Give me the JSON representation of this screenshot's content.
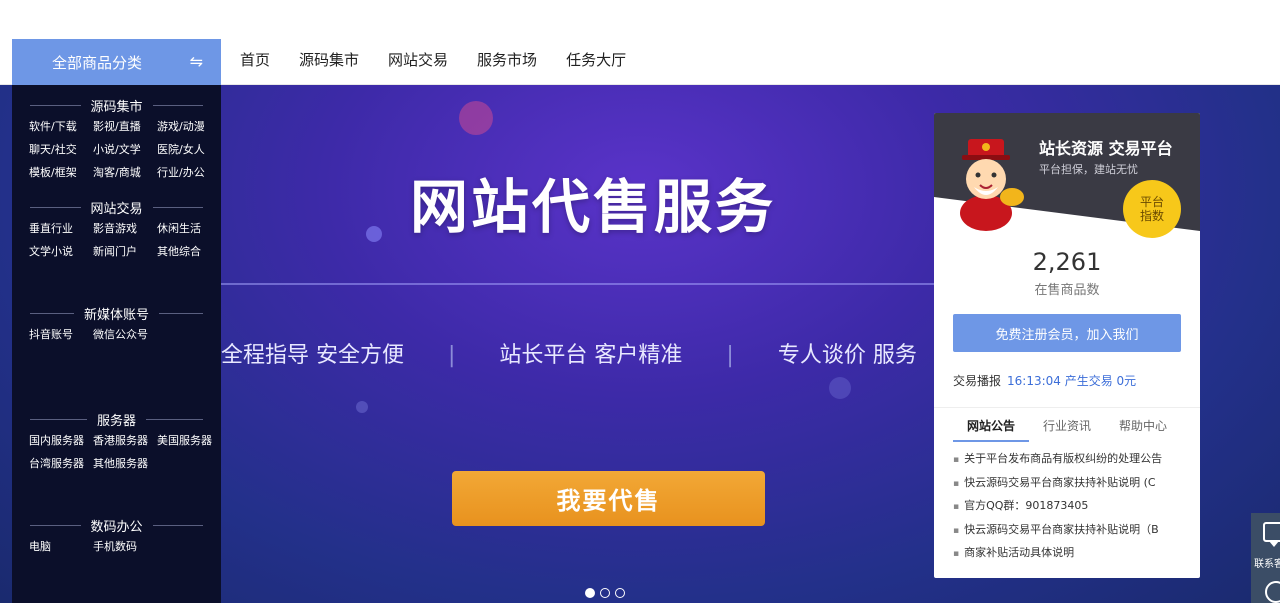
{
  "category_toggle": {
    "label": "全部商品分类",
    "icon": "swap-icon"
  },
  "nav": [
    "首页",
    "源码集市",
    "网站交易",
    "服务市场",
    "任务大厅"
  ],
  "categories": [
    {
      "title": "源码集市",
      "items": [
        "软件/下载",
        "影视/直播",
        "游戏/动漫",
        "聊天/社交",
        "小说/文学",
        "医院/女人",
        "模板/框架",
        "淘客/商城",
        "行业/办公"
      ]
    },
    {
      "title": "网站交易",
      "items": [
        "垂直行业",
        "影音游戏",
        "休闲生活",
        "文学小说",
        "新闻门户",
        "其他综合"
      ]
    },
    {
      "title": "新媒体账号",
      "items": [
        "抖音账号",
        "微信公众号"
      ]
    },
    {
      "title": "服务器",
      "items": [
        "国内服务器",
        "香港服务器",
        "美国服务器",
        "台湾服务器",
        "其他服务器"
      ]
    },
    {
      "title": "数码办公",
      "items": [
        "电脑",
        "手机数码"
      ]
    }
  ],
  "banner": {
    "title": "网站代售服务",
    "subtitles": [
      "全程指导 安全方便",
      "站长平台 客户精准",
      "专人谈价 服务"
    ],
    "cta": "我要代售",
    "slides_total": 3,
    "slide_active": 1
  },
  "card": {
    "title": "站长资源 交易平台",
    "subtitle": "平台担保，建站无忧",
    "badge_line1": "平台",
    "badge_line2": "指数",
    "count": "2,261",
    "count_label": "在售商品数",
    "register_btn": "免费注册会员，加入我们",
    "ticker_label": "交易播报",
    "ticker_text": "16:13:04 产生交易 0元",
    "tabs": [
      "网站公告",
      "行业资讯",
      "帮助中心"
    ],
    "active_tab": 0,
    "notices": [
      "关于平台发布商品有版权纠纷的处理公告",
      "快云源码交易平台商家扶持补贴说明  (C",
      "官方QQ群：901873405",
      "快云源码交易平台商家扶持补贴说明（B",
      "商家补贴活动具体说明"
    ]
  },
  "side_contact": {
    "label": "联系客服"
  },
  "colors": {
    "accent": "#6e97e6",
    "panel": "#0b0f2a",
    "cta": "#f0a22e",
    "badge": "#f7c81a"
  }
}
